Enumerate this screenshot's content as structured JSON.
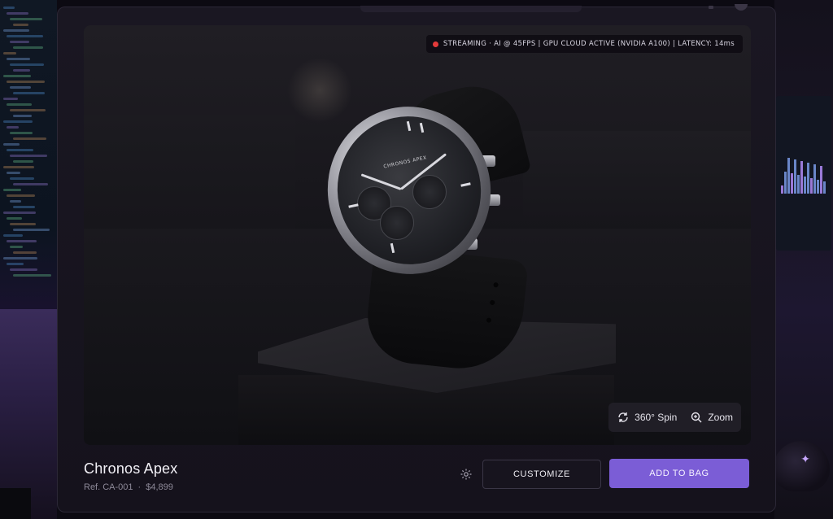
{
  "status": {
    "text": "STREAMING · AI @ 45FPS | GPU CLOUD ACTIVE (NVIDIA A100) | LATENCY: 14ms"
  },
  "viewer": {
    "spin_label": "360° Spin",
    "zoom_label": "Zoom",
    "dial_text": "CHRONOS APEX"
  },
  "product": {
    "name": "Chronos Apex",
    "ref": "Ref. CA-001",
    "separator": "·",
    "price": "$4,899"
  },
  "actions": {
    "customize_label": "CUSTOMIZE",
    "add_to_bag_label": "ADD TO BAG"
  },
  "colors": {
    "accent": "#7b5dd6",
    "recording": "#e33a3a"
  }
}
